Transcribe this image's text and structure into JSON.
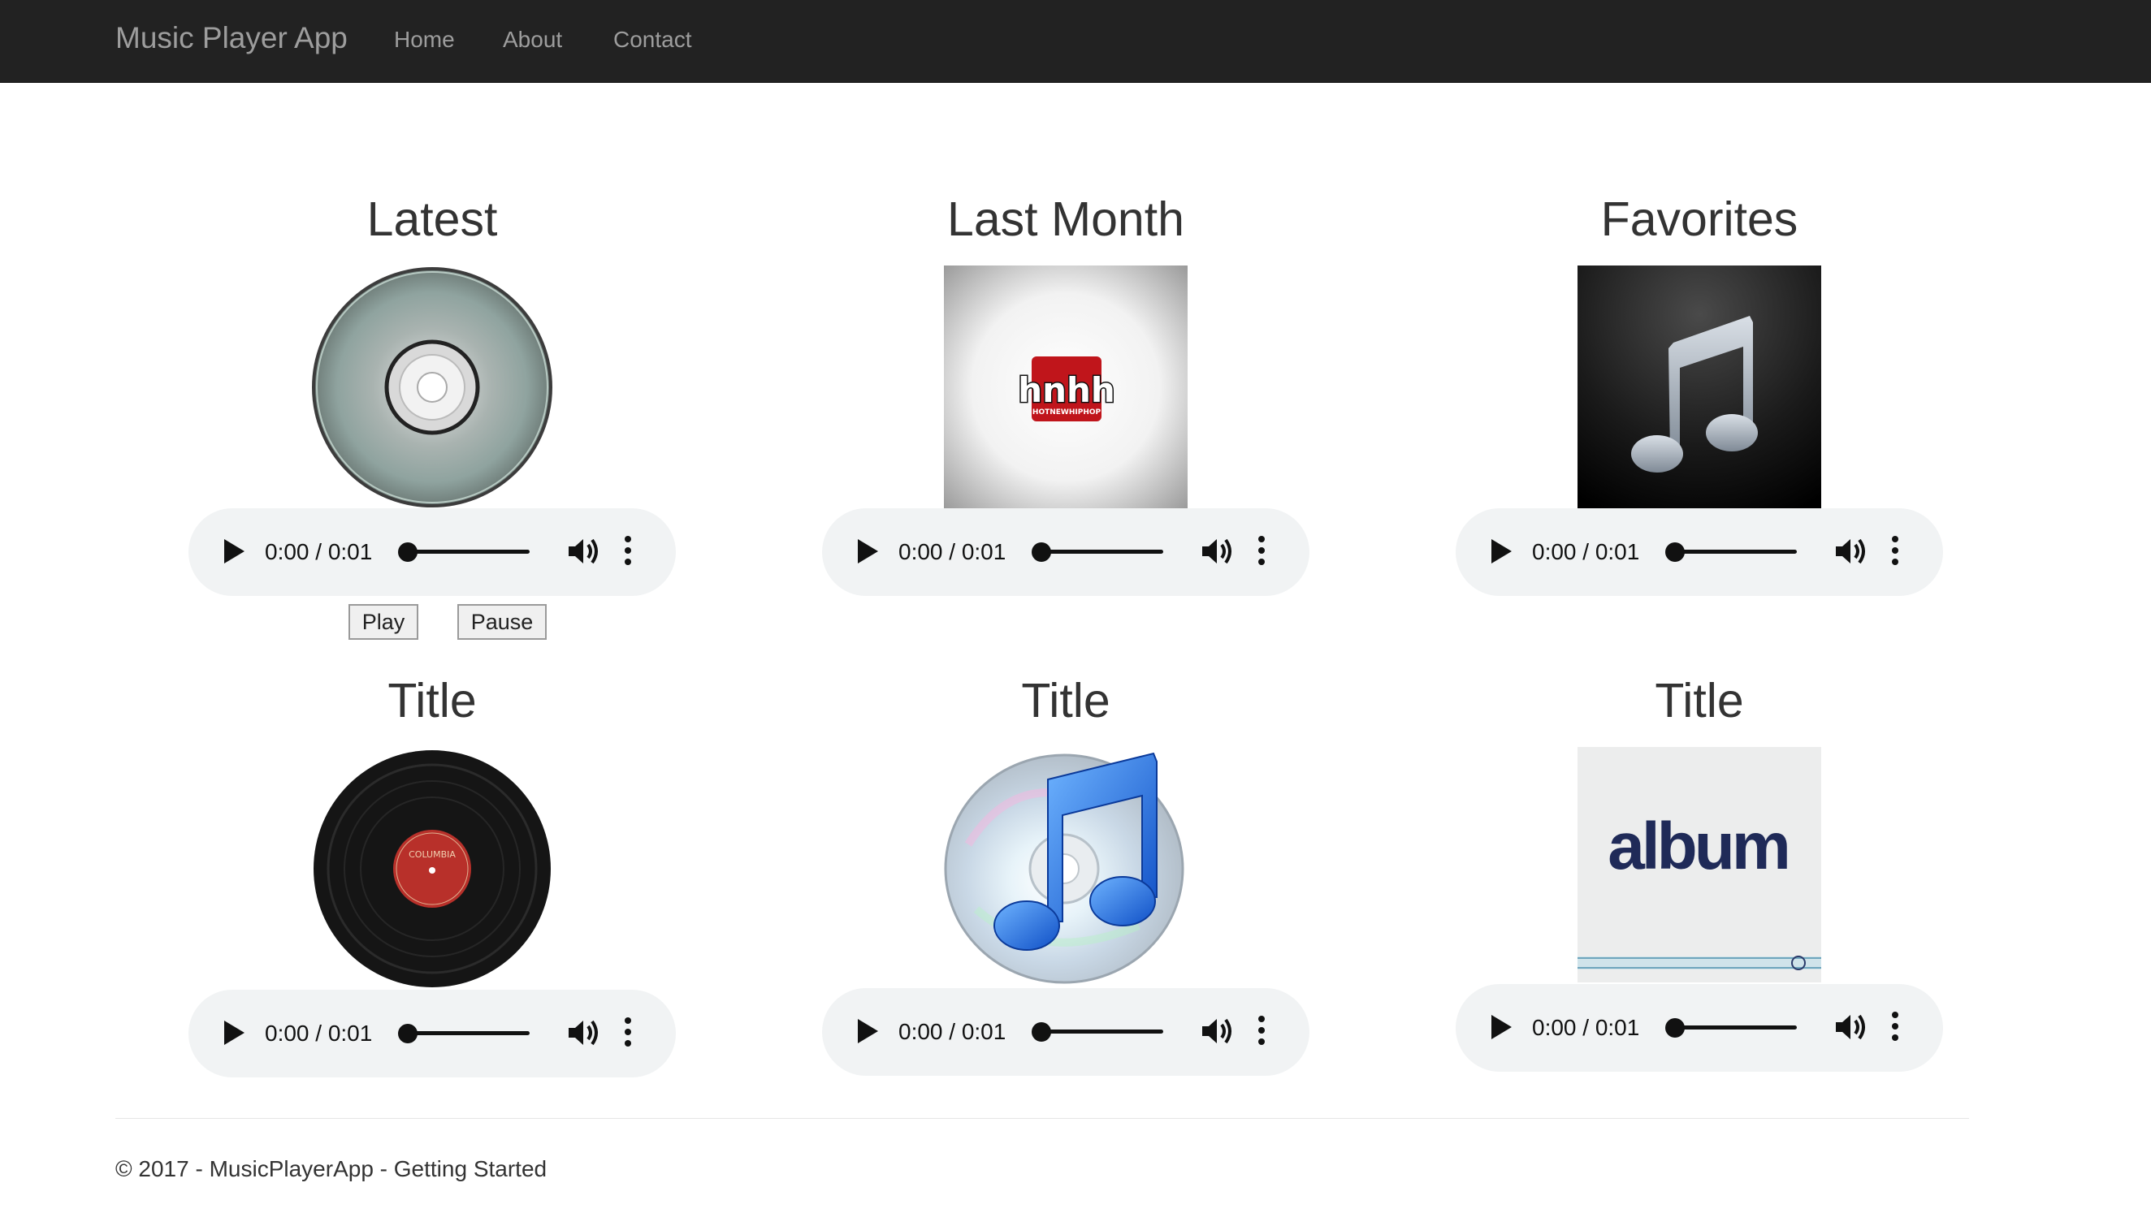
{
  "navbar": {
    "brand": "Music Player App",
    "links": [
      "Home",
      "About",
      "Contact"
    ]
  },
  "cards": [
    {
      "title": "Latest",
      "art": "cd-disc-image",
      "time": "0:00 / 0:01"
    },
    {
      "title": "Last Month",
      "art": "hnhh-hotnewhiphop-logo-image",
      "logo_text": "hnhh",
      "logo_subtext": "HOTNEWHIPHOP",
      "time": "0:00 / 0:01"
    },
    {
      "title": "Favorites",
      "art": "music-note-dark-image",
      "time": "0:00 / 0:01"
    },
    {
      "title": "Title",
      "art": "vinyl-record-columbia-image",
      "label_text": "COLUMBIA",
      "time": "0:00 / 0:01"
    },
    {
      "title": "Title",
      "art": "itunes-cd-music-note-image",
      "time": "0:00 / 0:01"
    },
    {
      "title": "Title",
      "art": "album-cover-image",
      "album_text": "album",
      "time": "0:00 / 0:01"
    }
  ],
  "controls": {
    "play_label": "Play",
    "pause_label": "Pause"
  },
  "footer": {
    "text": "© 2017 - MusicPlayerApp - Getting Started"
  },
  "colors": {
    "navbar_bg": "#222222",
    "nav_text": "#9d9d9d",
    "player_bg": "#f1f3f4"
  }
}
